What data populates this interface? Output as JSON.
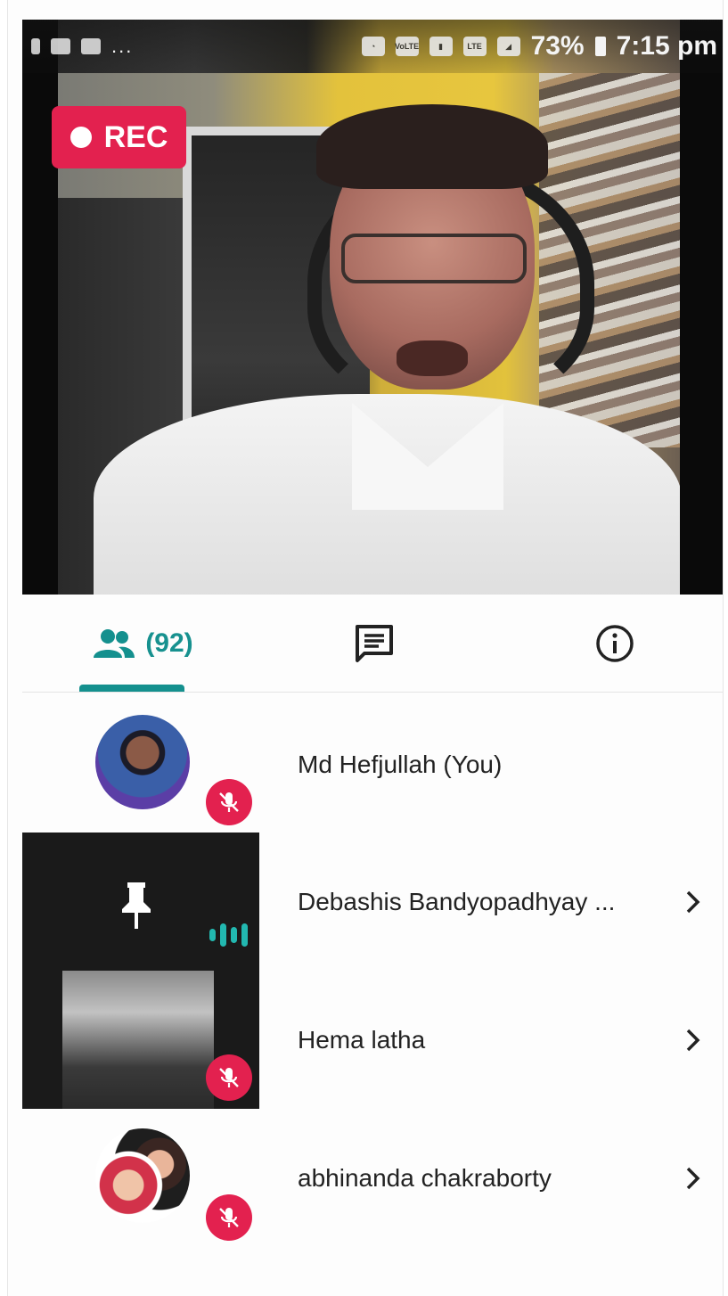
{
  "status_bar": {
    "battery": "73%",
    "time": "7:15 pm",
    "dots": "...",
    "network": "LTE",
    "volte": "VoLTE"
  },
  "video": {
    "rec_label": "REC"
  },
  "tabs": {
    "participants_count": "(92)",
    "participants_icon": "people-icon",
    "chat_icon": "chat-icon",
    "info_icon": "info-icon"
  },
  "participants": [
    {
      "name": "Md Hefjullah (You)",
      "muted": true,
      "has_chevron": false
    },
    {
      "name": "Debashis Bandyopadhyay ...",
      "speaking": true,
      "pinned": true,
      "has_chevron": true
    },
    {
      "name": "Hema latha",
      "muted": true,
      "has_chevron": true
    },
    {
      "name": "abhinanda chakraborty",
      "muted": true,
      "has_chevron": true
    }
  ],
  "colors": {
    "accent_teal": "#14908e",
    "rec_red": "#e3214f",
    "mute_red": "#e3214f",
    "speaking_teal": "#22b8b0"
  }
}
